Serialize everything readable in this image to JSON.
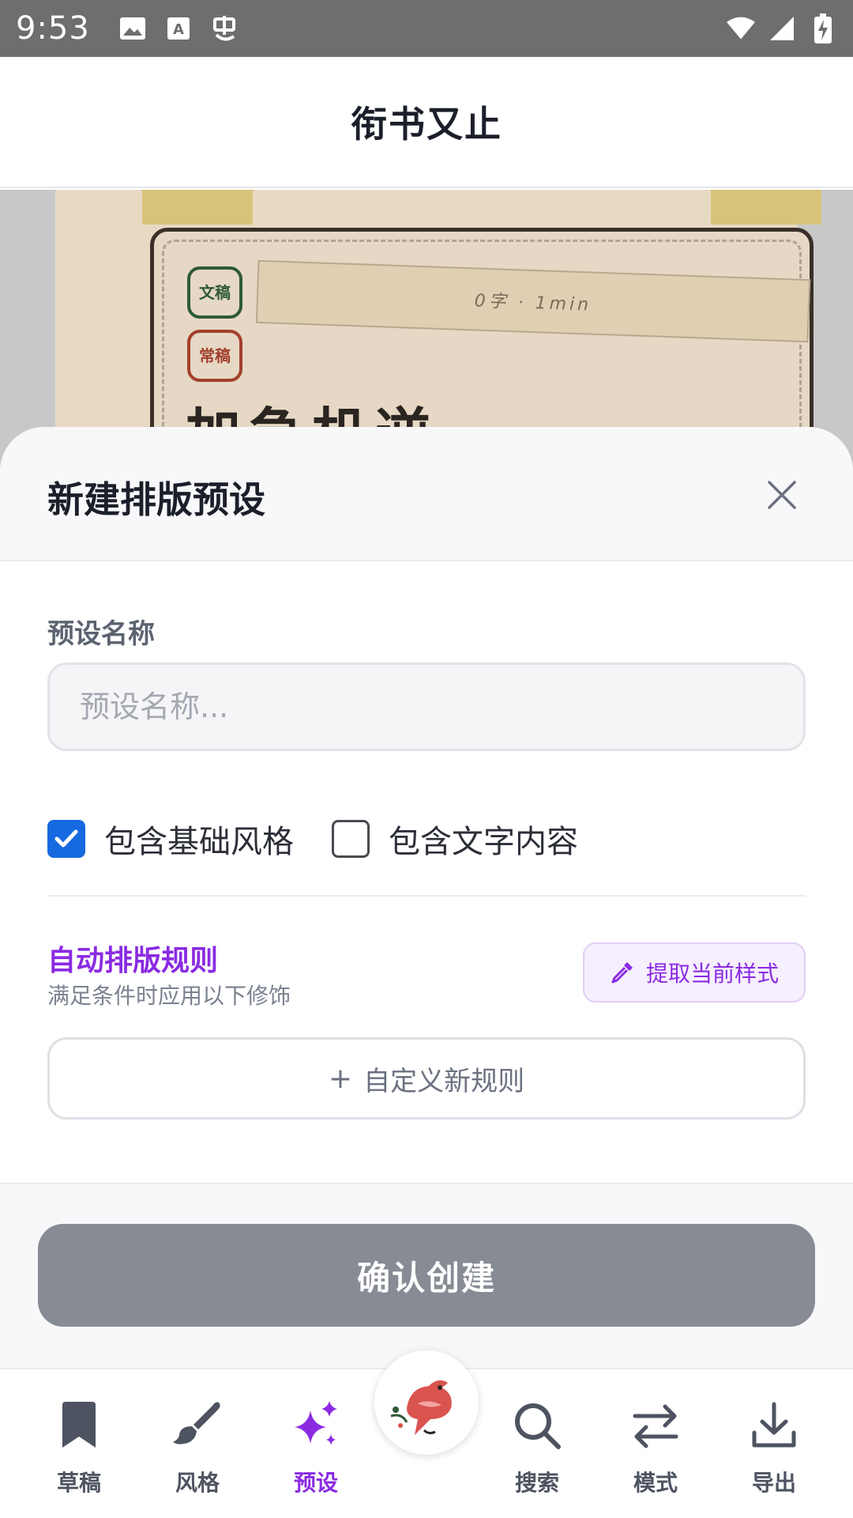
{
  "status_bar": {
    "time": "9:53",
    "icons": [
      "image-icon",
      "font-icon",
      "bug-icon",
      "wifi-icon",
      "signal-icon",
      "battery-charging-icon"
    ]
  },
  "header": {
    "title": "衔书又止"
  },
  "background_card": {
    "stamp_green": "文稿",
    "stamp_red": "常稿",
    "ribbon_text": "0字 · 1min",
    "big_text": "加急机逆"
  },
  "sheet": {
    "title": "新建排版预设",
    "name_field": {
      "label": "预设名称",
      "placeholder": "预设名称...",
      "value": ""
    },
    "checkboxes": [
      {
        "label": "包含基础风格",
        "checked": true
      },
      {
        "label": "包含文字内容",
        "checked": false
      }
    ],
    "rules": {
      "title": "自动排版规则",
      "subtitle": "满足条件时应用以下修饰",
      "extract_button": "提取当前样式",
      "add_rule": "自定义新规则"
    },
    "confirm_button": "确认创建"
  },
  "bottom_nav": {
    "items": [
      {
        "label": "草稿",
        "icon": "bookmark-icon",
        "active": false
      },
      {
        "label": "风格",
        "icon": "brush-icon",
        "active": false
      },
      {
        "label": "预设",
        "icon": "sparkles-icon",
        "active": true
      },
      {
        "label": "搜索",
        "icon": "search-icon",
        "active": false
      },
      {
        "label": "模式",
        "icon": "swap-icon",
        "active": false
      },
      {
        "label": "导出",
        "icon": "download-icon",
        "active": false
      }
    ],
    "center_icon": "bird-logo-icon"
  },
  "colors": {
    "accent": "#8a2be2",
    "checkbox": "#1769e0",
    "confirm_disabled": "#868b94",
    "status_bar": "#6e6e6e"
  }
}
